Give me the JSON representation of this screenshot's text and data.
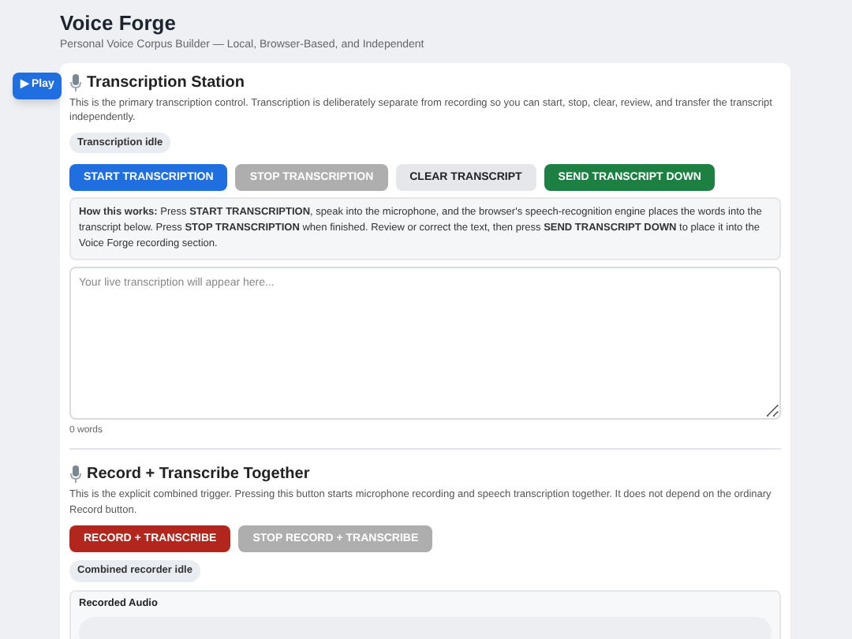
{
  "header": {
    "title": "Voice Forge",
    "subtitle": "Personal Voice Corpus Builder — Local, Browser-Based, and Independent"
  },
  "play_button": {
    "icon": "▶",
    "label": "Play"
  },
  "transcription": {
    "title": "Transcription Station",
    "description": "This is the primary transcription control. Transcription is deliberately separate from recording so you can start, stop, clear, review, and transfer the transcript independently.",
    "status": "Transcription idle",
    "buttons": [
      {
        "label": "START TRANSCRIPTION",
        "kind": "primary",
        "disabled": false
      },
      {
        "label": "STOP TRANSCRIPTION",
        "kind": "neutral",
        "disabled": true
      },
      {
        "label": "CLEAR TRANSCRIPT",
        "kind": "light",
        "disabled": false
      },
      {
        "label": "SEND TRANSCRIPT DOWN",
        "kind": "success",
        "disabled": false
      }
    ],
    "help": "**How this works:** Press **START TRANSCRIPTION**, speak into the microphone, and the browser's speech-recognition engine places the words into the transcript below. Press **STOP TRANSCRIPTION** when finished. Review or correct the text, then press **SEND TRANSCRIPT DOWN** to place it into the Voice Forge recording section.",
    "transcript": {
      "placeholder": "Your live transcription will appear here..."
    },
    "word_count": "0 words"
  },
  "combined": {
    "title": "Record + Transcribe Together",
    "description": "This is the explicit combined trigger. Pressing this button starts microphone recording and speech transcription together. It does not depend on the ordinary Record button.",
    "buttons": [
      {
        "label": "RECORD + TRANSCRIBE",
        "kind": "danger",
        "disabled": false
      },
      {
        "label": "STOP RECORD + TRANSCRIBE",
        "kind": "neutral",
        "disabled": true
      }
    ],
    "status": "Combined recorder idle",
    "audio": {
      "title": "Recorded Audio"
    }
  }
}
